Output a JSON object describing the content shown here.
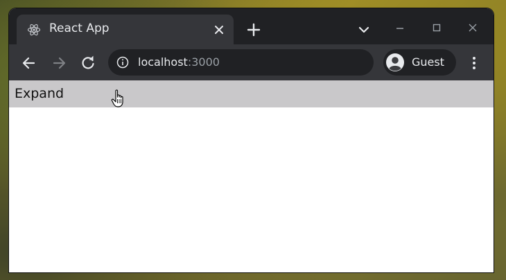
{
  "tab": {
    "title": "React App",
    "favicon": "react-atom-icon",
    "close_icon": "close-icon"
  },
  "titlebar": {
    "new_tab_icon": "plus-icon",
    "tab_search_icon": "chevron-down-icon",
    "minimize_icon": "minimize-icon",
    "maximize_icon": "maximize-icon",
    "close_window_icon": "close-icon"
  },
  "toolbar": {
    "back_icon": "arrow-left-icon",
    "forward_icon": "arrow-right-icon",
    "reload_icon": "reload-icon",
    "url_host": "localhost",
    "url_port": ":3000",
    "site_info_icon": "info-icon",
    "profile_name": "Guest",
    "profile_icon": "avatar-icon",
    "menu_icon": "kebab-menu-icon"
  },
  "page": {
    "expand_label": "Expand",
    "cursor": "hand-pointer-icon"
  },
  "colors": {
    "titlebar_bg": "#202124",
    "toolbar_bg": "#35363a",
    "expand_bar_bg": "#c9c8ca",
    "text_light": "#e8eaed"
  }
}
